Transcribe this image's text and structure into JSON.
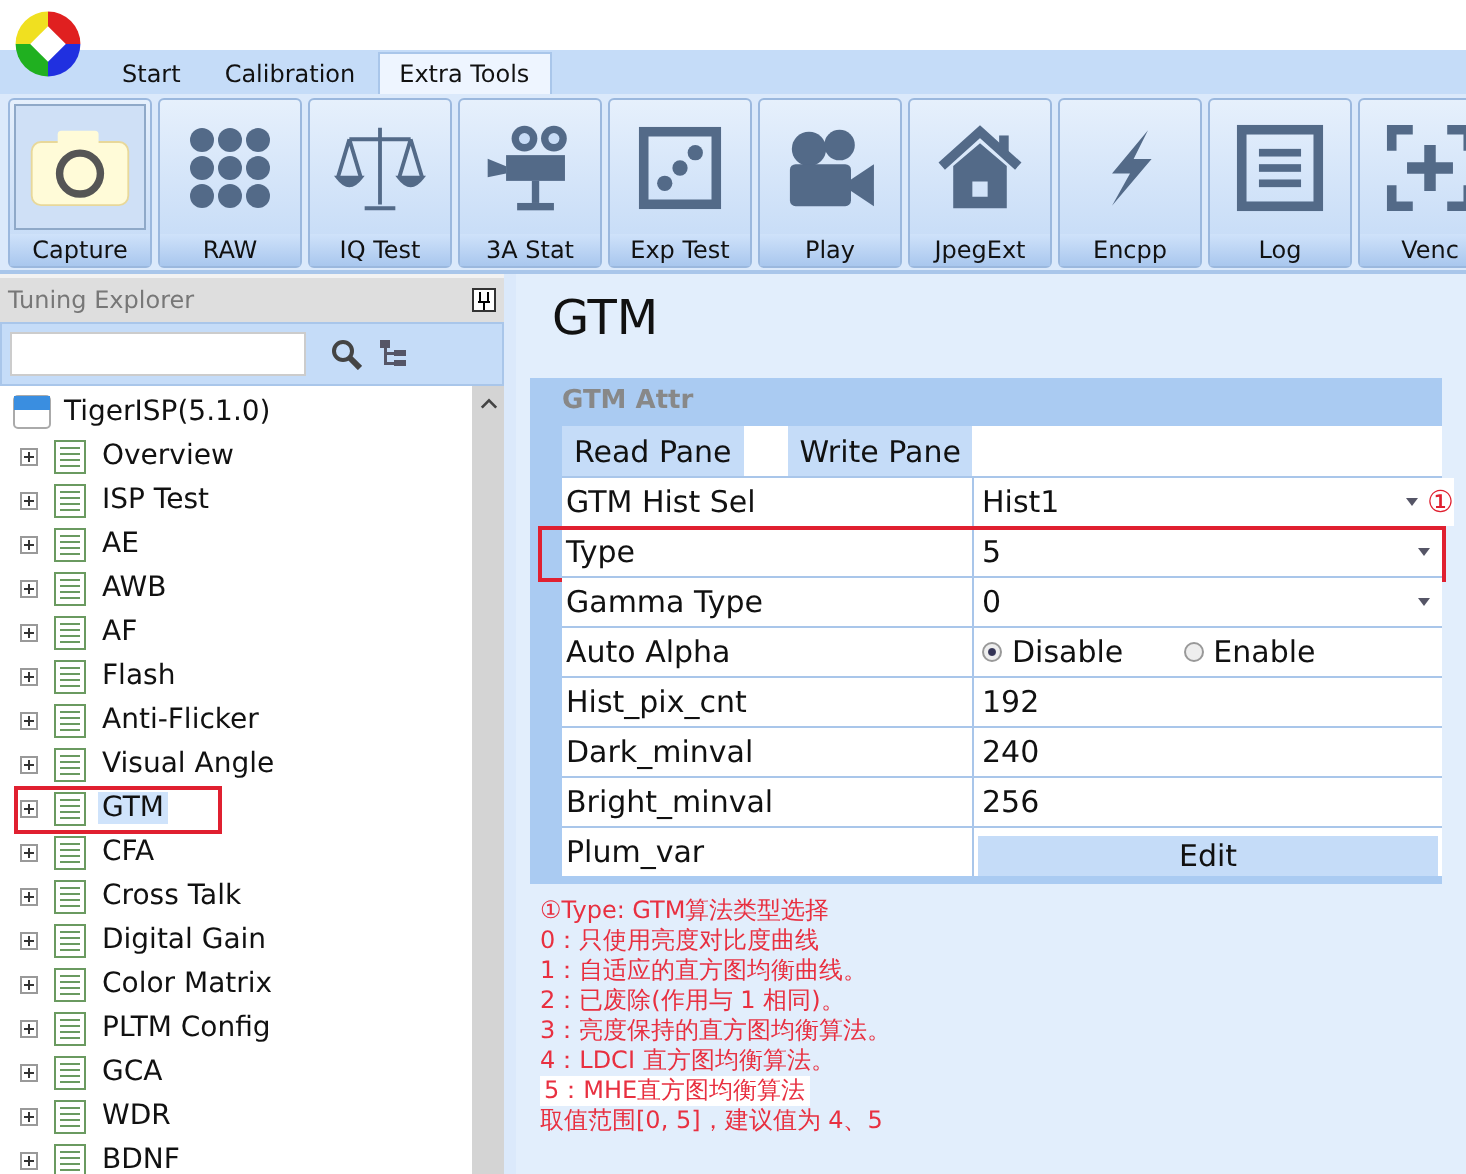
{
  "ribbon_tabs": [
    {
      "label": "Start",
      "selected": false
    },
    {
      "label": "Calibration",
      "selected": false
    },
    {
      "label": "Extra Tools",
      "selected": true
    }
  ],
  "toolbar": [
    {
      "label": "Capture",
      "selected": true
    },
    {
      "label": "RAW",
      "selected": false
    },
    {
      "label": "IQ Test",
      "selected": false
    },
    {
      "label": "3A Stat",
      "selected": false
    },
    {
      "label": "Exp Test",
      "selected": false
    },
    {
      "label": "Play",
      "selected": false
    },
    {
      "label": "JpegExt",
      "selected": false
    },
    {
      "label": "Encpp",
      "selected": false
    },
    {
      "label": "Log",
      "selected": false
    },
    {
      "label": "Venc",
      "selected": false
    }
  ],
  "explorer": {
    "title": "Tuning Explorer",
    "root": {
      "label": "TigerISP(5.1.0)",
      "children": [
        {
          "label": "Overview",
          "selected": false
        },
        {
          "label": "ISP Test",
          "selected": false
        },
        {
          "label": "AE",
          "selected": false
        },
        {
          "label": "AWB",
          "selected": false
        },
        {
          "label": "AF",
          "selected": false
        },
        {
          "label": "Flash",
          "selected": false
        },
        {
          "label": "Anti-Flicker",
          "selected": false
        },
        {
          "label": "Visual Angle",
          "selected": false
        },
        {
          "label": "GTM",
          "selected": true
        },
        {
          "label": "CFA",
          "selected": false
        },
        {
          "label": "Cross Talk",
          "selected": false
        },
        {
          "label": "Digital Gain",
          "selected": false
        },
        {
          "label": "Color Matrix",
          "selected": false
        },
        {
          "label": "PLTM Config",
          "selected": false
        },
        {
          "label": "GCA",
          "selected": false
        },
        {
          "label": "WDR",
          "selected": false
        },
        {
          "label": "BDNF",
          "selected": false
        }
      ]
    }
  },
  "page": {
    "title": "GTM",
    "group": "GTM Attr",
    "panes": [
      {
        "label": "Read Pane"
      },
      {
        "label": "Write Pane"
      }
    ],
    "rows": [
      {
        "kind": "combo",
        "label": "GTM Hist Sel",
        "value": "Hist1",
        "marker": "①"
      },
      {
        "kind": "combo",
        "label": "Type",
        "value": "5",
        "highlighted": true
      },
      {
        "kind": "combo",
        "label": "Gamma Type",
        "value": "0"
      },
      {
        "kind": "radio",
        "label": "Auto Alpha",
        "options": [
          {
            "label": "Disable",
            "selected": true
          },
          {
            "label": "Enable",
            "selected": false
          }
        ]
      },
      {
        "kind": "text",
        "label": "Hist_pix_cnt",
        "value": "192"
      },
      {
        "kind": "text",
        "label": "Dark_minval",
        "value": "240"
      },
      {
        "kind": "text",
        "label": "Bright_minval",
        "value": "256"
      },
      {
        "kind": "button",
        "label": "Plum_var",
        "value": "Edit"
      }
    ],
    "notes": [
      {
        "text": "①Type: GTM算法类型选择",
        "highlighted": false
      },
      {
        "text": "0：只使用亮度对比度曲线",
        "highlighted": false
      },
      {
        "text": "1：自适应的直方图均衡曲线。",
        "highlighted": false
      },
      {
        "text": "2：已废除(作用与 1 相同)。",
        "highlighted": false
      },
      {
        "text": "3：亮度保持的直方图均衡算法。",
        "highlighted": false
      },
      {
        "text": "4：LDCI 直方图均衡算法。",
        "highlighted": false
      },
      {
        "text": "5：MHE直方图均衡算法",
        "highlighted": true
      },
      {
        "text": "取值范围[0, 5]，建议值为 4、5",
        "highlighted": false
      }
    ]
  }
}
